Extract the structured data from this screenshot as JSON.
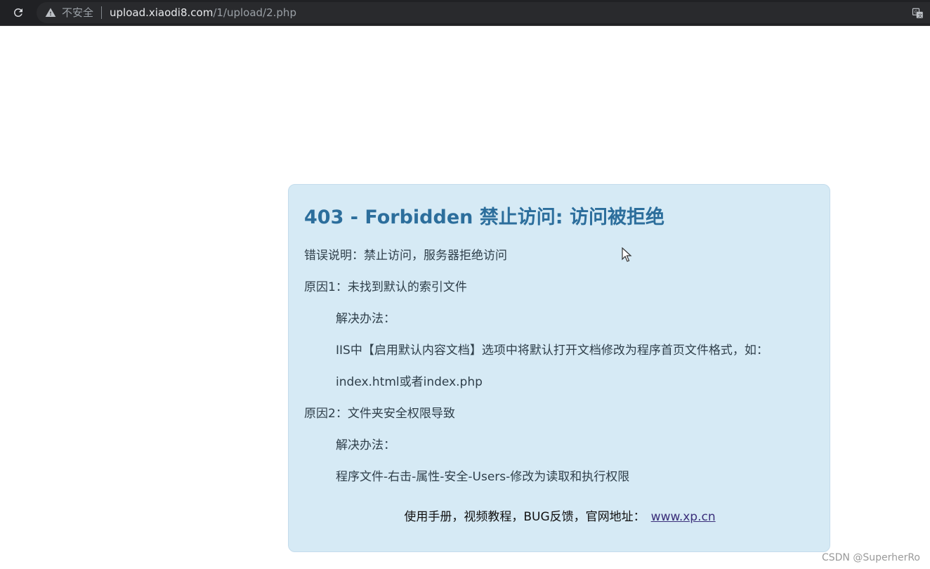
{
  "browser": {
    "security_label": "不安全",
    "url_host": "upload.xiaodi8.com",
    "url_path": "/1/upload/2.php",
    "icons": {
      "reload": "reload-icon",
      "warning": "warning-icon",
      "translate": "translate-icon"
    }
  },
  "error_page": {
    "title": "403 - Forbidden 禁止访问: 访问被拒绝",
    "lines": [
      "错误说明：禁止访问，服务器拒绝访问",
      "原因1：未找到默认的索引文件",
      "解决办法：",
      "IIS中【启用默认内容文档】选项中将默认打开文档修改为程序首页文件格式，如：",
      "index.html或者index.php",
      "原因2：文件夹安全权限导致",
      "解决办法：",
      "程序文件-右击-属性-安全-Users-修改为读取和执行权限"
    ],
    "footer_text": "使用手册，视频教程，BUG反馈，官网地址：",
    "footer_link": "www.xp.cn"
  },
  "watermark": "CSDN @SuperherRo",
  "colors": {
    "title": "#2c6e9c",
    "box_background": "#d6eaf5",
    "topbar": "#202124"
  }
}
